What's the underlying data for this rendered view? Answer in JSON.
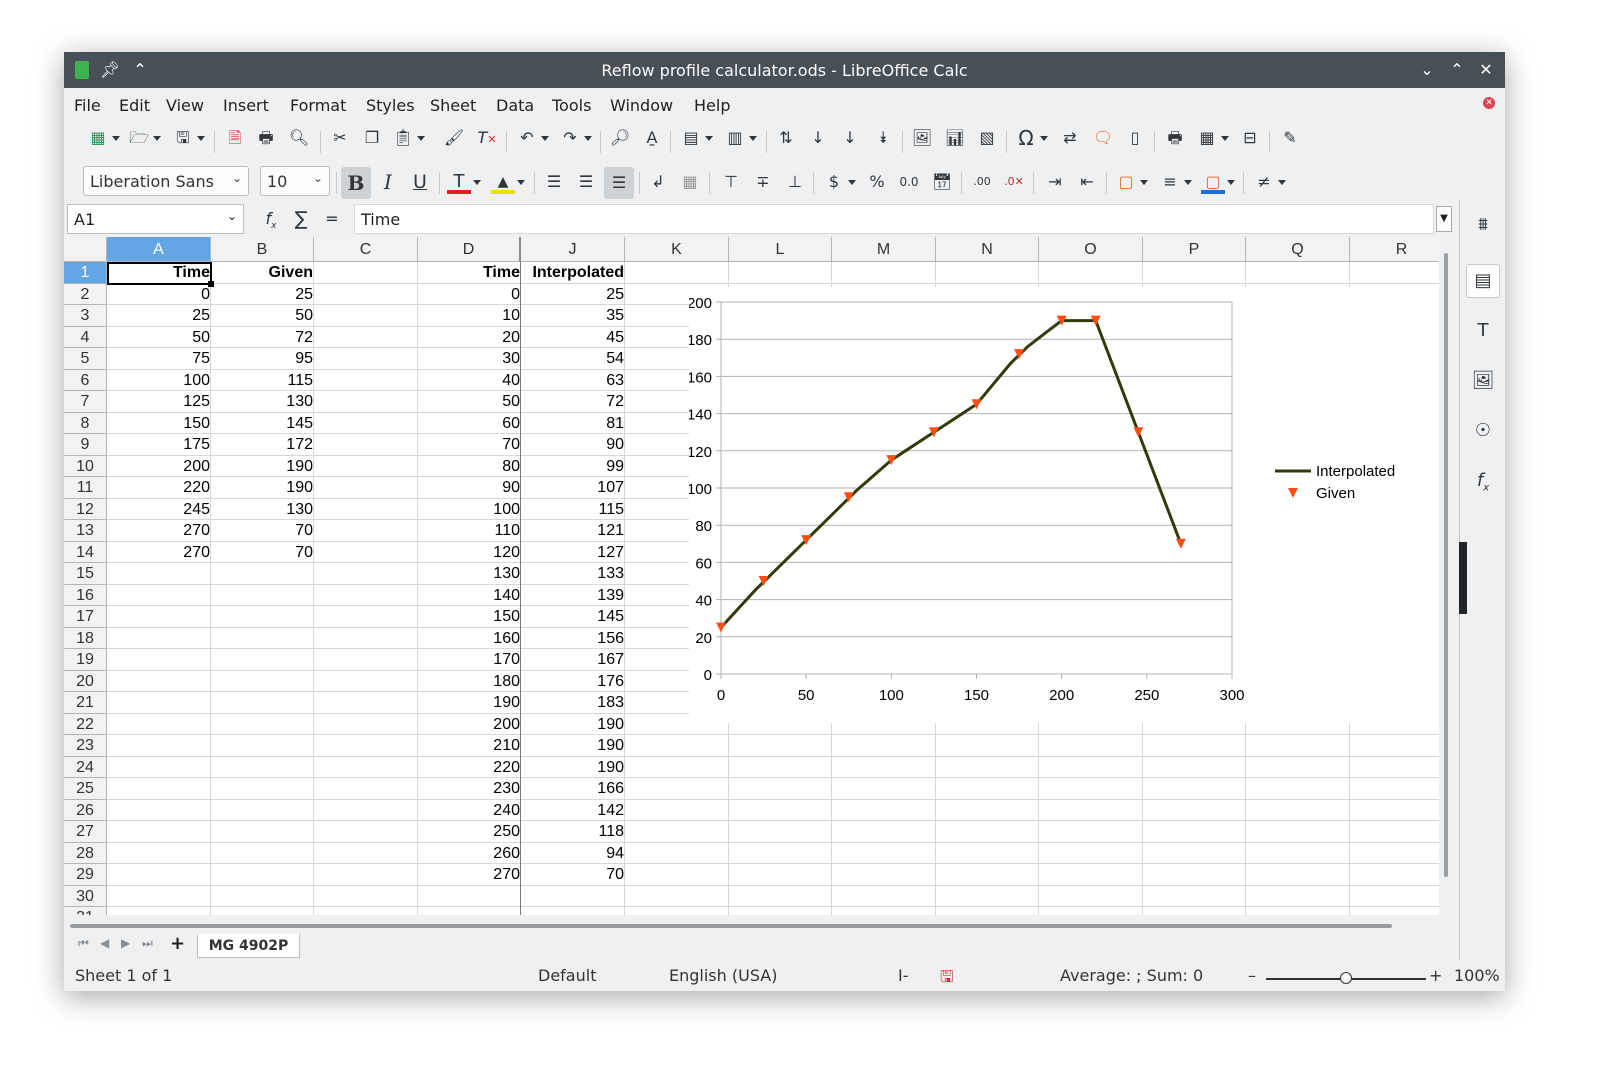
{
  "window": {
    "title": "Reflow profile calculator.ods - LibreOffice Calc"
  },
  "menu": [
    "File",
    "Edit",
    "View",
    "Insert",
    "Format",
    "Styles",
    "Sheet",
    "Data",
    "Tools",
    "Window",
    "Help"
  ],
  "formatting": {
    "font_name": "Liberation Sans",
    "font_size": "10"
  },
  "formula_bar": {
    "name_box": "A1",
    "content": "Time"
  },
  "grid": {
    "columns": [
      "A",
      "B",
      "C",
      "D",
      "J",
      "K",
      "L",
      "M",
      "N",
      "O",
      "P",
      "Q",
      "R"
    ],
    "selected_column": "A",
    "selected_row": "1",
    "rows": [
      "1",
      "2",
      "3",
      "4",
      "5",
      "6",
      "7",
      "8",
      "9",
      "10",
      "11",
      "12",
      "13",
      "14",
      "15",
      "16",
      "17",
      "18",
      "19",
      "20",
      "21",
      "22",
      "23",
      "24",
      "25",
      "26",
      "27",
      "28",
      "29",
      "30",
      "31"
    ],
    "col_A": [
      "Time",
      "0",
      "25",
      "50",
      "75",
      "100",
      "125",
      "150",
      "175",
      "200",
      "220",
      "245",
      "270",
      "270"
    ],
    "col_B": [
      "Given",
      "25",
      "50",
      "72",
      "95",
      "115",
      "130",
      "145",
      "172",
      "190",
      "190",
      "130",
      "70",
      "70"
    ],
    "col_D": [
      "Time",
      "0",
      "10",
      "20",
      "30",
      "40",
      "50",
      "60",
      "70",
      "80",
      "90",
      "100",
      "110",
      "120",
      "130",
      "140",
      "150",
      "160",
      "170",
      "180",
      "190",
      "200",
      "210",
      "220",
      "230",
      "240",
      "250",
      "260",
      "270"
    ],
    "col_J": [
      "Interpolated",
      "25",
      "35",
      "45",
      "54",
      "63",
      "72",
      "81",
      "90",
      "99",
      "107",
      "115",
      "121",
      "127",
      "133",
      "139",
      "145",
      "156",
      "167",
      "176",
      "183",
      "190",
      "190",
      "190",
      "166",
      "142",
      "118",
      "94",
      "70"
    ]
  },
  "chart_data": {
    "type": "line",
    "title": "",
    "xlabel": "",
    "ylabel": "",
    "xlim": [
      0,
      300
    ],
    "ylim": [
      0,
      200
    ],
    "x_ticks": [
      "0",
      "50",
      "100",
      "150",
      "200",
      "250",
      "300"
    ],
    "y_ticks": [
      "0",
      "20",
      "40",
      "60",
      "80",
      "100",
      "120",
      "140",
      "160",
      "180",
      "200"
    ],
    "grid": true,
    "legend": "right",
    "series": [
      {
        "name": "Interpolated",
        "kind": "line",
        "color": "#2f3c09",
        "x": [
          0,
          10,
          20,
          30,
          40,
          50,
          60,
          70,
          80,
          90,
          100,
          110,
          120,
          130,
          140,
          150,
          160,
          170,
          180,
          190,
          200,
          210,
          220,
          230,
          240,
          250,
          260,
          270
        ],
        "y": [
          25,
          35,
          45,
          54,
          63,
          72,
          81,
          90,
          99,
          107,
          115,
          121,
          127,
          133,
          139,
          145,
          156,
          167,
          176,
          183,
          190,
          190,
          190,
          166,
          142,
          118,
          94,
          70
        ]
      },
      {
        "name": "Given",
        "kind": "marker",
        "color": "#ff4e12",
        "x": [
          0,
          25,
          50,
          75,
          100,
          125,
          150,
          175,
          200,
          220,
          245,
          270
        ],
        "y": [
          25,
          50,
          72,
          95,
          115,
          130,
          145,
          172,
          190,
          190,
          130,
          70
        ]
      }
    ]
  },
  "sheet_tabs": {
    "active": "MG 4902P"
  },
  "status_bar": {
    "sheet": "Sheet 1 of 1",
    "page_style": "Default",
    "language": "English (USA)",
    "summary": "Average: ; Sum: 0",
    "zoom": "100%"
  }
}
